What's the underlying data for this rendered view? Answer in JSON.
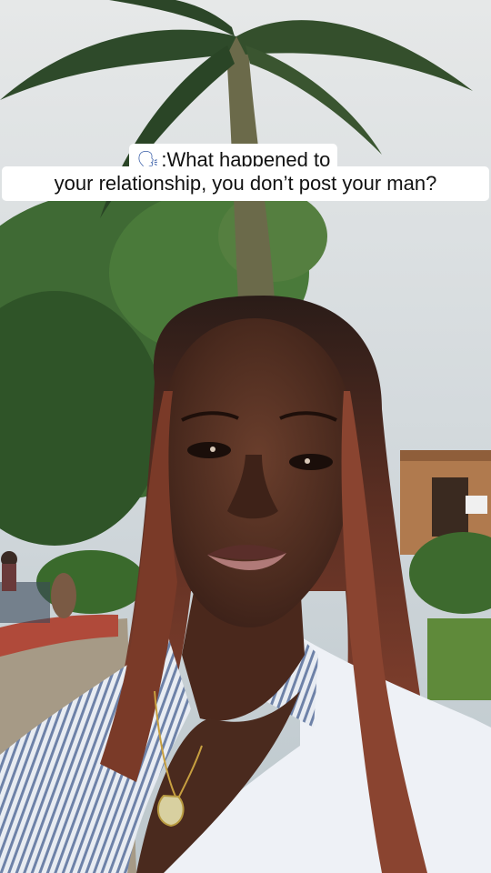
{
  "caption": {
    "line1_icon": "speaking-head-icon",
    "line1_text": ":What happened to",
    "line2_text": "your relationship, you don’t post your man?"
  },
  "colors": {
    "caption_background": "#ffffff",
    "caption_text": "#111111"
  }
}
